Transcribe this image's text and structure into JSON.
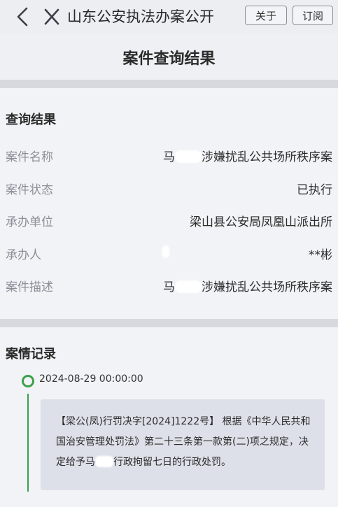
{
  "nav": {
    "title": "山东公安执法办案公开",
    "about_label": "关于",
    "subscribe_label": "订阅"
  },
  "header": {
    "title": "案件查询结果"
  },
  "result": {
    "heading": "查询结果",
    "rows": [
      {
        "label": "案件名称",
        "value_prefix": "马",
        "value_suffix": "涉嫌扰乱公共场所秩序案"
      },
      {
        "label": "案件状态",
        "value": "已执行"
      },
      {
        "label": "承办单位",
        "value": "梁山县公安局凤凰山派出所"
      },
      {
        "label": "承办人",
        "value": "**彬"
      },
      {
        "label": "案件描述",
        "value_prefix": "马",
        "value_suffix": "涉嫌扰乱公共场所秩序案"
      }
    ]
  },
  "record": {
    "heading": "案情记录",
    "timestamp": "2024-08-29 00:00:00",
    "text_part1": "【梁公(凤)行罚决字[2024]1222号】 根据《中华人民共和国治安管理处罚法》第二十三条第一款第(二)项之规定，决定给予马",
    "text_part2": "行政拘留七日的行政处罚。"
  },
  "colors": {
    "accent_green": "#3aa14a",
    "label_gray": "#8b8f98"
  }
}
